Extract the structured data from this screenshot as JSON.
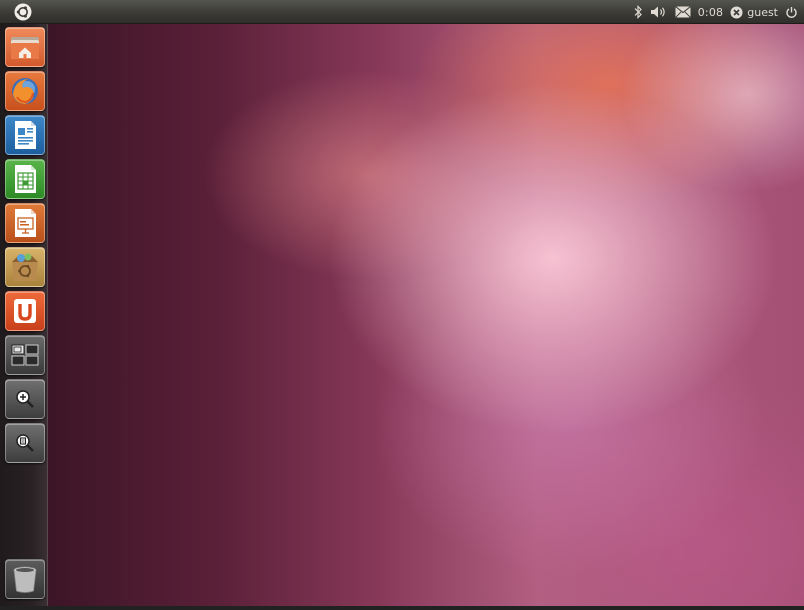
{
  "top_panel": {
    "clock": "0:08",
    "user": "guest"
  },
  "launcher": {
    "items": [
      {
        "name": "home-folder",
        "icon": "home-folder-icon"
      },
      {
        "name": "firefox",
        "icon": "firefox-icon"
      },
      {
        "name": "libreoffice-writer",
        "icon": "writer-document-icon"
      },
      {
        "name": "libreoffice-calc",
        "icon": "calc-spreadsheet-icon"
      },
      {
        "name": "libreoffice-impress",
        "icon": "impress-presentation-icon"
      },
      {
        "name": "ubuntu-software-center",
        "icon": "software-center-icon"
      },
      {
        "name": "ubuntu-one",
        "icon": "ubuntu-one-icon"
      },
      {
        "name": "workspace-switcher",
        "icon": "workspace-switcher-icon"
      },
      {
        "name": "applications-lens",
        "icon": "applications-lens-icon"
      },
      {
        "name": "files-lens",
        "icon": "files-lens-icon"
      },
      {
        "name": "trash",
        "icon": "trash-icon"
      }
    ]
  },
  "colors": {
    "panel": "#3c3b37",
    "panel_text": "#dfdbd2",
    "wallpaper_accent": "#b06080"
  }
}
